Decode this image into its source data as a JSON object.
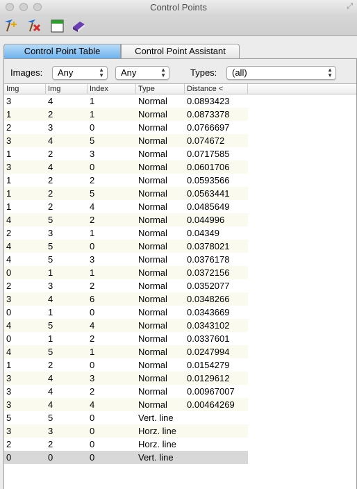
{
  "window": {
    "title": "Control Points"
  },
  "toolbar": {
    "buttons": [
      {
        "icon": "add-point-icon",
        "color": "#1f6fd1"
      },
      {
        "icon": "delete-point-icon",
        "color": "#d22b2b"
      },
      {
        "icon": "table-window-icon",
        "color": "#2a9d2a"
      },
      {
        "icon": "book-icon",
        "color": "#6b3fb3"
      }
    ]
  },
  "tabs": [
    {
      "label": "Control Point Table",
      "active": true
    },
    {
      "label": "Control Point Assistant",
      "active": false
    }
  ],
  "filters": {
    "images_label": "Images:",
    "image1_value": "Any",
    "image2_value": "Any",
    "types_label": "Types:",
    "types_value": "(all)"
  },
  "table": {
    "columns": [
      "Img",
      "Img",
      "Index",
      "Type",
      "Distance <"
    ],
    "rows": [
      [
        "3",
        "4",
        "1",
        "Normal",
        "0.0893423"
      ],
      [
        "1",
        "2",
        "1",
        "Normal",
        "0.0873378"
      ],
      [
        "2",
        "3",
        "0",
        "Normal",
        "0.0766697"
      ],
      [
        "3",
        "4",
        "5",
        "Normal",
        "0.074672"
      ],
      [
        "1",
        "2",
        "3",
        "Normal",
        "0.0717585"
      ],
      [
        "3",
        "4",
        "0",
        "Normal",
        "0.0601706"
      ],
      [
        "1",
        "2",
        "2",
        "Normal",
        "0.0593566"
      ],
      [
        "1",
        "2",
        "5",
        "Normal",
        "0.0563441"
      ],
      [
        "1",
        "2",
        "4",
        "Normal",
        "0.0485649"
      ],
      [
        "4",
        "5",
        "2",
        "Normal",
        "0.044996"
      ],
      [
        "2",
        "3",
        "1",
        "Normal",
        "0.04349"
      ],
      [
        "4",
        "5",
        "0",
        "Normal",
        "0.0378021"
      ],
      [
        "4",
        "5",
        "3",
        "Normal",
        "0.0376178"
      ],
      [
        "0",
        "1",
        "1",
        "Normal",
        "0.0372156"
      ],
      [
        "2",
        "3",
        "2",
        "Normal",
        "0.0352077"
      ],
      [
        "3",
        "4",
        "6",
        "Normal",
        "0.0348266"
      ],
      [
        "0",
        "1",
        "0",
        "Normal",
        "0.0343669"
      ],
      [
        "4",
        "5",
        "4",
        "Normal",
        "0.0343102"
      ],
      [
        "0",
        "1",
        "2",
        "Normal",
        "0.0337601"
      ],
      [
        "4",
        "5",
        "1",
        "Normal",
        "0.0247994"
      ],
      [
        "1",
        "2",
        "0",
        "Normal",
        "0.0154279"
      ],
      [
        "3",
        "4",
        "3",
        "Normal",
        "0.0129612"
      ],
      [
        "3",
        "4",
        "2",
        "Normal",
        "0.00967007"
      ],
      [
        "3",
        "4",
        "4",
        "Normal",
        "0.00464269"
      ],
      [
        "5",
        "5",
        "0",
        "Vert. line",
        ""
      ],
      [
        "3",
        "3",
        "0",
        "Horz. line",
        ""
      ],
      [
        "2",
        "2",
        "0",
        "Horz. line",
        ""
      ],
      [
        "0",
        "0",
        "0",
        "Vert. line",
        ""
      ]
    ],
    "selected_row": 27
  }
}
